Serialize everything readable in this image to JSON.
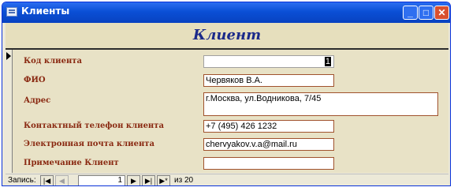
{
  "window": {
    "title": "Клиенты",
    "app_icon": "form-window-icon"
  },
  "title_buttons": {
    "minimize": "_",
    "maximize": "□",
    "close": "✕"
  },
  "form": {
    "title": "Клиент",
    "fields": [
      {
        "label": "Код клиента",
        "value": "1"
      },
      {
        "label": "ФИО",
        "value": "Червяков В.А."
      },
      {
        "label": "Адрес",
        "value": "г.Москва, ул.Водникова, 7/45"
      },
      {
        "label": "Контактный телефон клиента",
        "value": "+7 (495) 426 1232"
      },
      {
        "label": "Электронная почта клиента",
        "value": "chervyakov.v.a@mail.ru"
      },
      {
        "label": "Примечание Клиент",
        "value": ""
      }
    ]
  },
  "navigation": {
    "record_label": "Запись:",
    "first": "|◀",
    "prev": "◀",
    "current": "1",
    "next": "▶",
    "last": "▶|",
    "new": "▶*",
    "of_label": "из",
    "total": "20"
  },
  "colors": {
    "titlebar": "#0a4fd6",
    "label": "#8a2a12",
    "form_title": "#1b2a8a",
    "field_border": "#a0522d"
  }
}
